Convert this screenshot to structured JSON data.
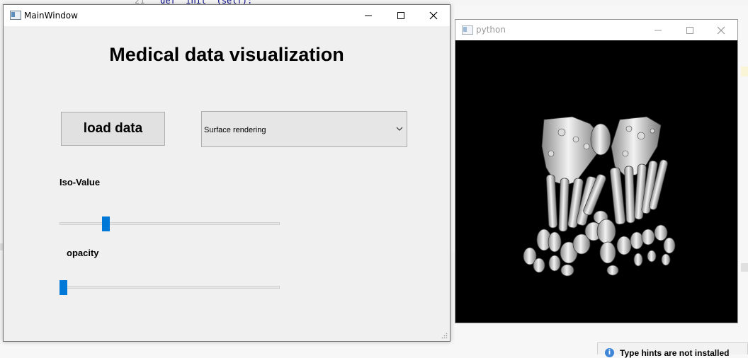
{
  "background_ide": {
    "code_line_number": "21",
    "code_line": "def  init  (self):"
  },
  "main_window": {
    "title": "MainWindow",
    "heading": "Medical data visualization",
    "load_button_label": "load data",
    "render_mode": {
      "selected": "Surface rendering"
    },
    "iso_value_label": "Iso-Value",
    "iso_value_slider": {
      "fraction": 0.2
    },
    "opacity_label": "opacity",
    "opacity_slider": {
      "fraction": 0.0
    },
    "accent_color": "#0078d7"
  },
  "render_window": {
    "title": "python"
  },
  "notification": {
    "text": "Type hints are not installed"
  }
}
